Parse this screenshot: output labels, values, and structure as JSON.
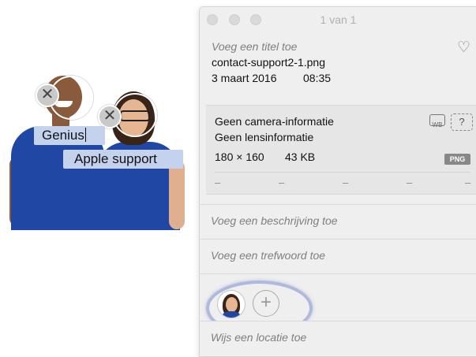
{
  "photo": {
    "faces": [
      {
        "name_value": "Genius"
      },
      {
        "name_value": "Apple support"
      }
    ],
    "remove_glyph": "✕"
  },
  "panel": {
    "window_title": "1 van 1",
    "title_placeholder": "Voeg een titel toe",
    "filename": "contact-support2-1.png",
    "date": "3 maart 2016",
    "time": "08:35",
    "favorite_icon": "heart-icon",
    "metadata": {
      "camera": "Geen camera-informatie",
      "lens": "Geen lensinformatie",
      "dimensions": "180 × 160",
      "filesize": "43 KB",
      "format_badge": "PNG",
      "help_label": "?",
      "wb_label": "WB",
      "exif_values": [
        "–",
        "–",
        "–",
        "–",
        "–"
      ]
    },
    "description_placeholder": "Voeg een beschrijving toe",
    "keyword_placeholder": "Voeg een trefwoord toe",
    "add_person_label": "+",
    "location_placeholder": "Wijs een locatie toe"
  },
  "colors": {
    "shirt": "#1f47a3",
    "name_tag": "#c5d2ee",
    "highlight_ring": "#aeb9dd"
  }
}
